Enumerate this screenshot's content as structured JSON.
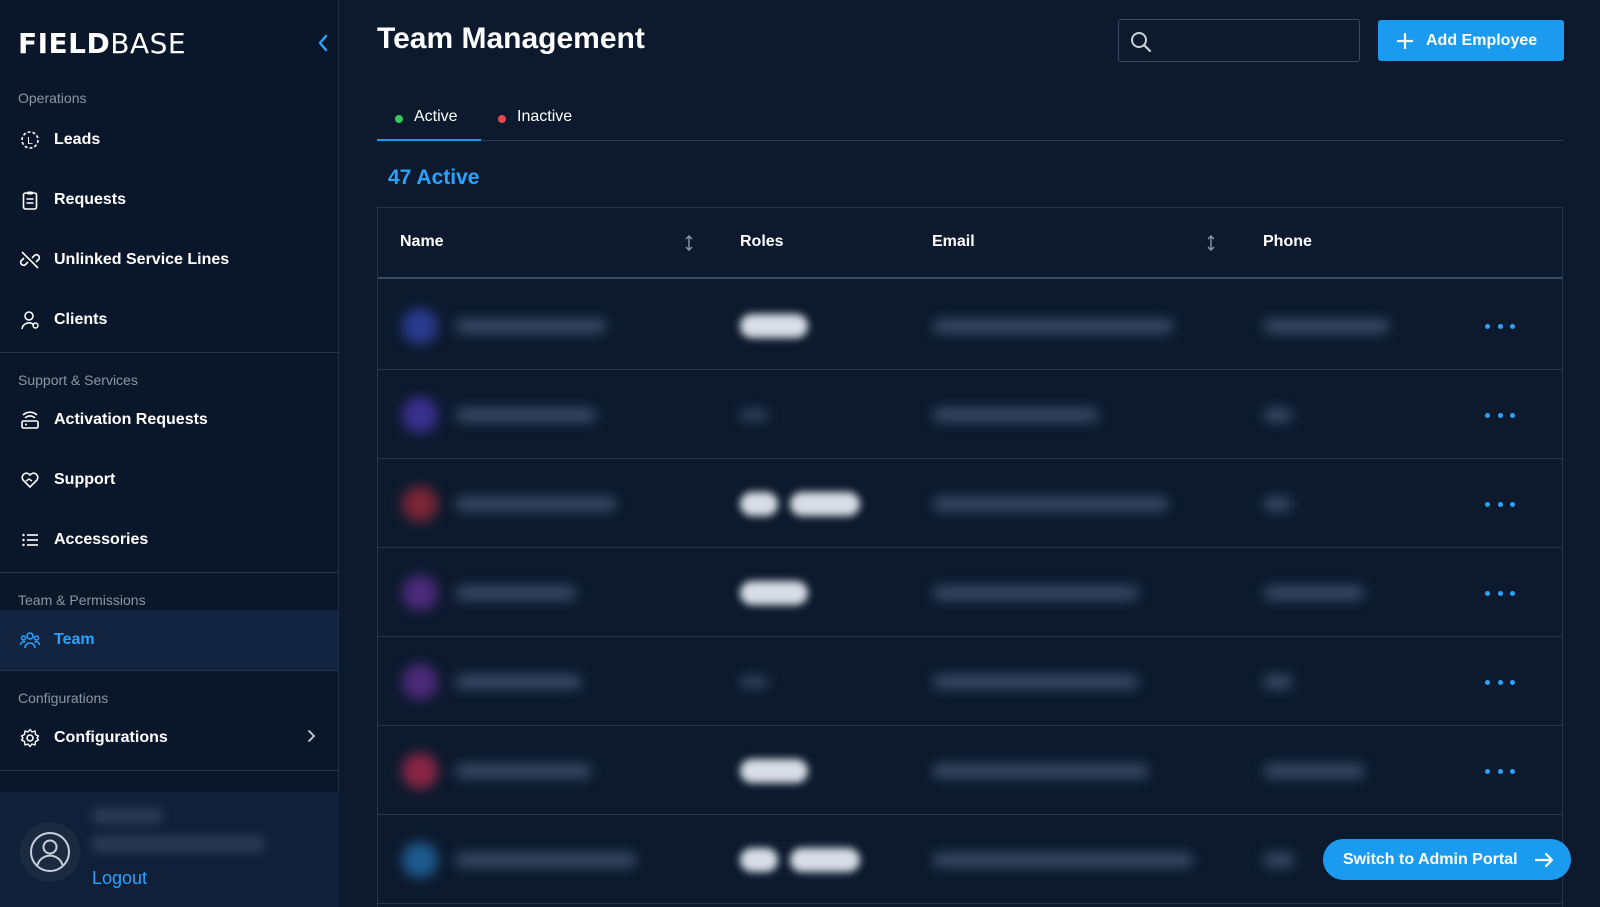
{
  "app": {
    "logo_part1": "FIELD",
    "logo_part2": "BASE"
  },
  "sidebar": {
    "sections": [
      {
        "label": "Operations",
        "items": [
          {
            "label": "Leads",
            "icon": "leads-icon"
          },
          {
            "label": "Requests",
            "icon": "clipboard-icon"
          },
          {
            "label": "Unlinked Service Lines",
            "icon": "unlink-icon"
          },
          {
            "label": "Clients",
            "icon": "user-icon"
          }
        ]
      },
      {
        "label": "Support & Services",
        "items": [
          {
            "label": "Activation Requests",
            "icon": "router-icon"
          },
          {
            "label": "Support",
            "icon": "heart-hand-icon"
          },
          {
            "label": "Accessories",
            "icon": "list-icon"
          }
        ]
      },
      {
        "label": "Team & Permissions",
        "items": [
          {
            "label": "Team",
            "icon": "team-icon",
            "active": true
          }
        ]
      },
      {
        "label": "Configurations",
        "items": [
          {
            "label": "Configurations",
            "icon": "gear-icon",
            "has_submenu": true
          }
        ]
      }
    ],
    "user": {
      "logout_label": "Logout"
    }
  },
  "header": {
    "title": "Team Management",
    "search": {
      "placeholder": "",
      "value": ""
    },
    "add_button_label": "Add Employee"
  },
  "tabs": [
    {
      "label": "Active",
      "dot_color": "#34c759",
      "active": true
    },
    {
      "label": "Inactive",
      "dot_color": "#e5484d",
      "active": false
    }
  ],
  "count_label": "47 Active",
  "table": {
    "columns": [
      {
        "label": "Name",
        "sortable": true
      },
      {
        "label": "Roles",
        "sortable": false
      },
      {
        "label": "Email",
        "sortable": true
      },
      {
        "label": "Phone",
        "sortable": false
      }
    ],
    "rows": [
      {
        "avatar_color": "#2a3b8f",
        "role_badges": 1
      },
      {
        "avatar_color": "#3b2f8f",
        "role_badges": 0
      },
      {
        "avatar_color": "#7a2535",
        "role_badges": 2
      },
      {
        "avatar_color": "#4b2a7a",
        "role_badges": 1
      },
      {
        "avatar_color": "#4b2a7a",
        "role_badges": 0
      },
      {
        "avatar_color": "#8a2545",
        "role_badges": 1
      },
      {
        "avatar_color": "#1d5a8f",
        "role_badges": 2
      }
    ]
  },
  "switch_portal_label": "Switch to Admin Portal",
  "colors": {
    "accent": "#1a9bf0",
    "sidebar_bg": "#0a1629",
    "main_bg": "#0d1a2e"
  }
}
